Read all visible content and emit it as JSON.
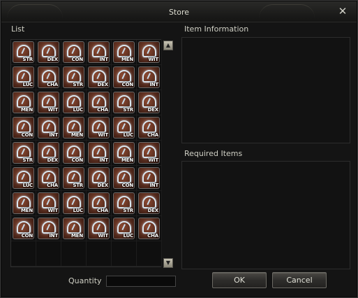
{
  "window": {
    "title": "Store",
    "close_glyph": "✕"
  },
  "labels": {
    "list": "List",
    "item_information": "Item Information",
    "required_items": "Required Items",
    "quantity": "Quantity"
  },
  "quantity": {
    "value": ""
  },
  "buttons": {
    "ok": "OK",
    "cancel": "Cancel"
  },
  "scroll": {
    "up_glyph": "▲",
    "down_glyph": "▼"
  },
  "items": [
    {
      "tag": "STR",
      "color": "red"
    },
    {
      "tag": "DEX",
      "color": "red"
    },
    {
      "tag": "CON",
      "color": "red"
    },
    {
      "tag": "INT",
      "color": "red"
    },
    {
      "tag": "MEN",
      "color": "red"
    },
    {
      "tag": "WIT",
      "color": "red"
    },
    {
      "tag": "LUC",
      "color": "red"
    },
    {
      "tag": "CHA",
      "color": "red"
    },
    {
      "tag": "STR",
      "color": "red"
    },
    {
      "tag": "DEX",
      "color": "red"
    },
    {
      "tag": "CON",
      "color": "red"
    },
    {
      "tag": "INT",
      "color": "red"
    },
    {
      "tag": "MEN",
      "color": "red"
    },
    {
      "tag": "WIT",
      "color": "red"
    },
    {
      "tag": "LUC",
      "color": "red"
    },
    {
      "tag": "CHA",
      "color": "red"
    },
    {
      "tag": "STR",
      "color": "red"
    },
    {
      "tag": "DEX",
      "color": "red"
    },
    {
      "tag": "CON",
      "color": "red"
    },
    {
      "tag": "INT",
      "color": "red"
    },
    {
      "tag": "MEN",
      "color": "red"
    },
    {
      "tag": "WIT",
      "color": "red"
    },
    {
      "tag": "LUC",
      "color": "red"
    },
    {
      "tag": "CHA",
      "color": "red"
    },
    {
      "tag": "STR",
      "color": "red"
    },
    {
      "tag": "DEX",
      "color": "red"
    },
    {
      "tag": "CON",
      "color": "red"
    },
    {
      "tag": "INT",
      "color": "red"
    },
    {
      "tag": "MEN",
      "color": "red"
    },
    {
      "tag": "WIT",
      "color": "red"
    },
    {
      "tag": "LUC",
      "color": "red"
    },
    {
      "tag": "CHA",
      "color": "red"
    },
    {
      "tag": "STR",
      "color": "red"
    },
    {
      "tag": "DEX",
      "color": "red"
    },
    {
      "tag": "CON",
      "color": "red"
    },
    {
      "tag": "INT",
      "color": "red"
    },
    {
      "tag": "MEN",
      "color": "red"
    },
    {
      "tag": "WIT",
      "color": "red"
    },
    {
      "tag": "LUC",
      "color": "red"
    },
    {
      "tag": "CHA",
      "color": "red"
    },
    {
      "tag": "STR",
      "color": "red"
    },
    {
      "tag": "DEX",
      "color": "red"
    },
    {
      "tag": "CON",
      "color": "red"
    },
    {
      "tag": "INT",
      "color": "red"
    },
    {
      "tag": "MEN",
      "color": "red"
    },
    {
      "tag": "WIT",
      "color": "red"
    },
    {
      "tag": "LUC",
      "color": "red"
    },
    {
      "tag": "CHA",
      "color": "red"
    }
  ],
  "empty_slots": 6,
  "colors": {
    "item_border": "#6a6a6a",
    "item_glow": "#d9e6ef"
  }
}
